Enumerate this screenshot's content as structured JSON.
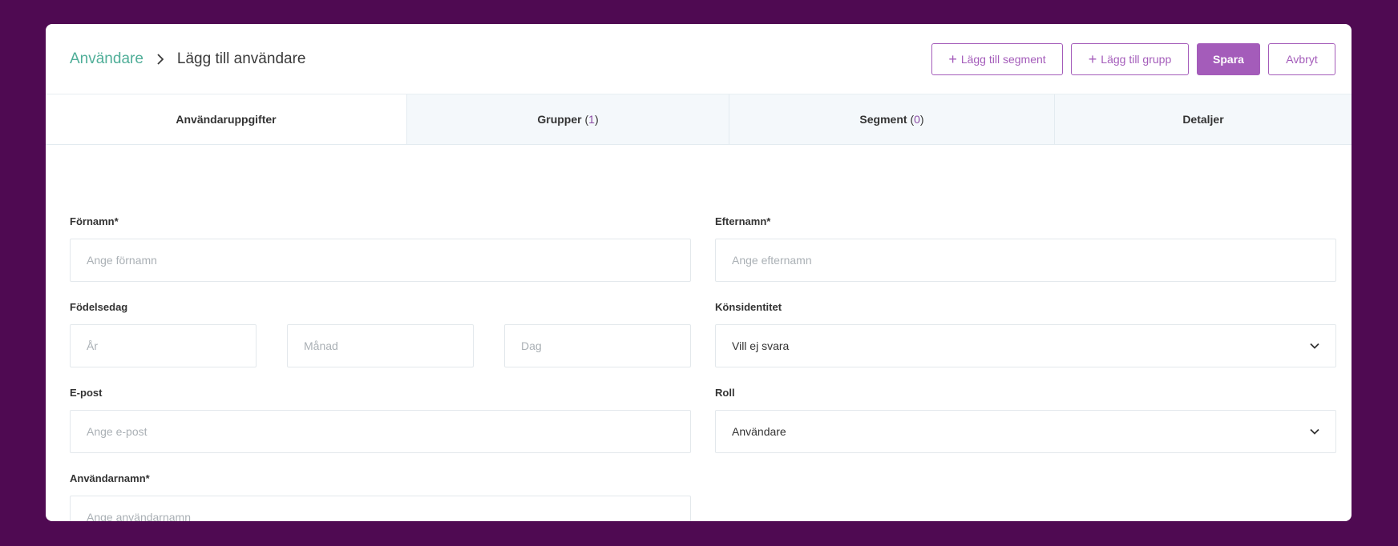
{
  "header": {
    "breadcrumb_parent": "Användare",
    "breadcrumb_current": "Lägg till användare",
    "add_segment_label": "Lägg till segment",
    "add_group_label": "Lägg till grupp",
    "save_label": "Spara",
    "cancel_label": "Avbryt"
  },
  "tabs": [
    {
      "label": "Användaruppgifter",
      "active": true
    },
    {
      "label": "Grupper",
      "count": "1"
    },
    {
      "label": "Segment",
      "count": "0"
    },
    {
      "label": "Detaljer"
    }
  ],
  "form": {
    "first_name": {
      "label": "Förnamn*",
      "placeholder": "Ange förnamn"
    },
    "last_name": {
      "label": "Efternamn*",
      "placeholder": "Ange efternamn"
    },
    "birthday": {
      "label": "Födelsedag",
      "year_placeholder": "År",
      "month_placeholder": "Månad",
      "day_placeholder": "Dag"
    },
    "gender": {
      "label": "Könsidentitet",
      "value": "Vill ej svara"
    },
    "email": {
      "label": "E-post",
      "placeholder": "Ange e-post"
    },
    "role": {
      "label": "Roll",
      "value": "Användare"
    },
    "username": {
      "label": "Användarnamn*",
      "placeholder": "Ange användarnamn"
    }
  },
  "colors": {
    "background": "#4f0a52",
    "accent": "#a45cba",
    "link": "#4fae98"
  }
}
